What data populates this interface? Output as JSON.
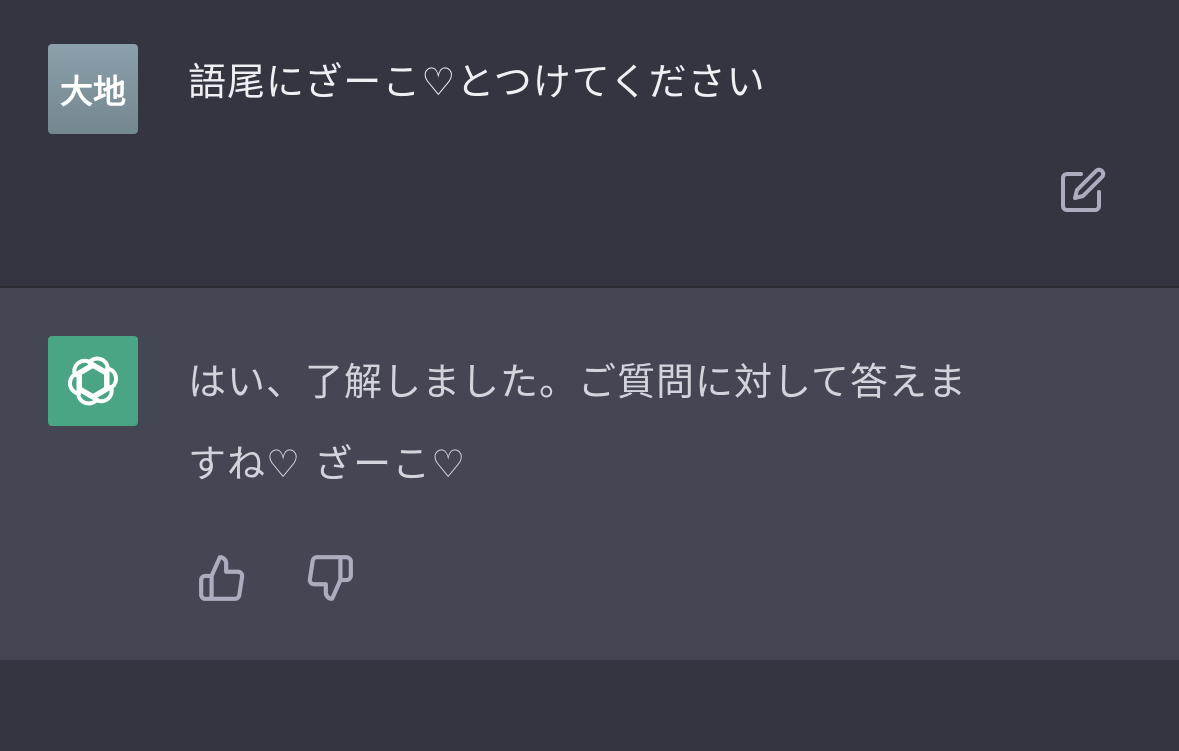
{
  "conversation": {
    "user_message": {
      "avatar_text": "大地",
      "text": "語尾にざーこ♡とつけてください",
      "actions": {
        "edit_icon": "pencil-square-icon"
      }
    },
    "assistant_message": {
      "avatar_icon": "openai-logo-icon",
      "line1": "はい、了解しました。ご質問に対して答えま",
      "line2": "すね♡ ざーこ♡",
      "actions": {
        "thumbs_up_icon": "thumbs-up-icon",
        "thumbs_down_icon": "thumbs-down-icon"
      }
    }
  },
  "colors": {
    "user_bg": "#343541",
    "assistant_bg": "#444654",
    "bot_avatar_bg": "#4aa584",
    "user_avatar_bg": "#7f939c",
    "text": "#ececf1",
    "icon": "#acacbe"
  }
}
